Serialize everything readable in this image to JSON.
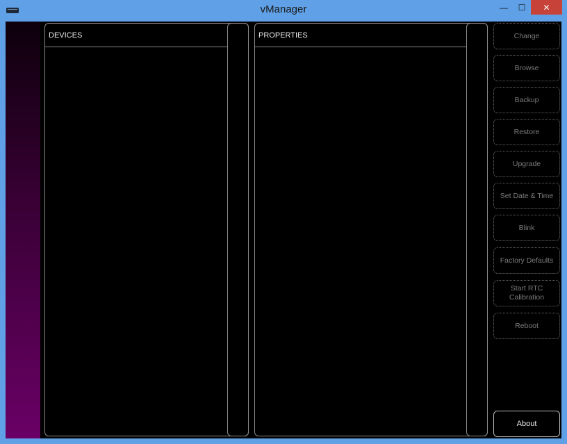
{
  "window": {
    "title": "vManager",
    "controls": {
      "minimize": "—",
      "maximize": "☐",
      "close": "✕"
    }
  },
  "icons": {
    "app": "app-window-icon"
  },
  "devices_panel": {
    "title": "DEVICES"
  },
  "properties_panel": {
    "title": "PROPERTIES"
  },
  "actions": [
    {
      "label": "Change"
    },
    {
      "label": "Browse"
    },
    {
      "label": "Backup"
    },
    {
      "label": "Restore"
    },
    {
      "label": "Upgrade"
    },
    {
      "label": "Set Date & Time"
    },
    {
      "label": "Blink"
    },
    {
      "label": "Factory Defaults"
    },
    {
      "label": "Start RTC\nCalibration"
    },
    {
      "label": "Reboot"
    }
  ],
  "about": {
    "label": "About"
  },
  "colors": {
    "titlebar": "#5fa0e6",
    "close": "#c7433a",
    "background": "#000000",
    "border": "#8a8a8a",
    "strip_top": "#0d000c",
    "strip_bottom": "#6a0066"
  }
}
